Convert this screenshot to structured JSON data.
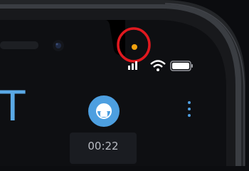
{
  "app": {
    "letter": "T",
    "timer": "00:22",
    "menu_icon": "more-vert-icon",
    "record_icon": "record-icon"
  },
  "status_bar": {
    "privacy_indicator": "orange-dot-icon",
    "icons": [
      "signal-icon",
      "wifi-icon",
      "battery-icon"
    ]
  },
  "highlight": {
    "type": "red-circle-annotation",
    "color": "#e0191f"
  },
  "colors": {
    "accent": "#4d9fe0",
    "indicator": "#f2a20f"
  }
}
